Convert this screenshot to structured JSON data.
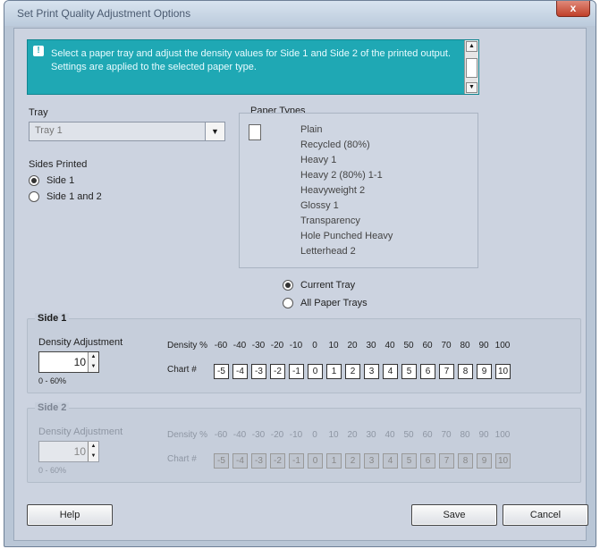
{
  "window": {
    "title": "Set Print Quality Adjustment Options",
    "close_label": "x"
  },
  "banner": {
    "icon": "info-icon",
    "text": "Select a paper tray and adjust the density values for Side 1 and Side 2 of the printed output. Settings are applied to the selected paper type."
  },
  "tray": {
    "label": "Tray",
    "value": "Tray 1"
  },
  "sides": {
    "label": "Sides Printed",
    "options": [
      "Side 1",
      "Side 1 and 2"
    ],
    "selected": 0
  },
  "paper_types": {
    "label": "Paper Types",
    "icon": "document-icon",
    "items": [
      "Plain",
      "Recycled (80%)",
      "Heavy 1",
      "Heavy 2 (80%) 1-1",
      "Heavyweight 2",
      "Glossy 1",
      "Transparency",
      "Hole Punched Heavy",
      "Letterhead 2"
    ]
  },
  "apply": {
    "options": [
      "Current Tray",
      "All Paper Trays"
    ],
    "selected": 0
  },
  "side1": {
    "title": "Side 1",
    "field_label": "Density Adjustment",
    "value": "10",
    "range": "0 - 60%",
    "density_label": "Density %",
    "chart_label": "Chart #",
    "densities": [
      "-60",
      "-40",
      "-30",
      "-20",
      "-10",
      "0",
      "10",
      "20",
      "30",
      "40",
      "50",
      "60",
      "70",
      "80",
      "90",
      "100"
    ],
    "charts": [
      "-5",
      "-4",
      "-3",
      "-2",
      "-1",
      "0",
      "1",
      "2",
      "3",
      "4",
      "5",
      "6",
      "7",
      "8",
      "9",
      "10"
    ]
  },
  "side2": {
    "title": "Side 2",
    "field_label": "Density Adjustment",
    "value": "10",
    "range": "0 - 60%",
    "density_label": "Density %",
    "chart_label": "Chart #",
    "densities": [
      "-60",
      "-40",
      "-30",
      "-20",
      "-10",
      "0",
      "10",
      "20",
      "30",
      "40",
      "50",
      "60",
      "70",
      "80",
      "90",
      "100"
    ],
    "charts": [
      "-5",
      "-4",
      "-3",
      "-2",
      "-1",
      "0",
      "1",
      "2",
      "3",
      "4",
      "5",
      "6",
      "7",
      "8",
      "9",
      "10"
    ]
  },
  "buttons": {
    "help": "Help",
    "save": "Save",
    "cancel": "Cancel"
  }
}
